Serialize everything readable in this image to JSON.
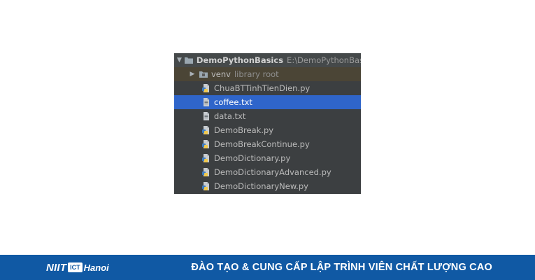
{
  "tree": {
    "root": {
      "name": "DemoPythonBasics",
      "path": "E:\\DemoPythonBasics",
      "expanded": true
    },
    "venv": {
      "name": "venv",
      "hint": "library root",
      "expanded": false
    },
    "files": [
      {
        "name": "ChuaBTTinhTienDien.py",
        "type": "python"
      },
      {
        "name": "coffee.txt",
        "type": "text",
        "selected": true
      },
      {
        "name": "data.txt",
        "type": "text"
      },
      {
        "name": "DemoBreak.py",
        "type": "python"
      },
      {
        "name": "DemoBreakContinue.py",
        "type": "python"
      },
      {
        "name": "DemoDictionary.py",
        "type": "python"
      },
      {
        "name": "DemoDictionaryAdvanced.py",
        "type": "python"
      },
      {
        "name": "DemoDictionaryNew.py",
        "type": "python"
      }
    ]
  },
  "footer": {
    "logo_niit": "NIIT",
    "logo_ict": "ICT",
    "logo_hanoi": "Hanoi",
    "slogan": "ĐÀO TẠO & CUNG CẤP LẬP TRÌNH VIÊN CHẤT LƯỢNG CAO"
  },
  "colors": {
    "panel_bg": "#3c3f41",
    "selection": "#2f65ca",
    "footer_bg": "#1059a4",
    "python_blue": "#3f7cbf",
    "python_yellow": "#f2c94c"
  },
  "icons": {
    "root": "folder-icon",
    "venv": "library-folder-icon",
    "python": "python-file-icon",
    "text": "text-file-icon"
  }
}
